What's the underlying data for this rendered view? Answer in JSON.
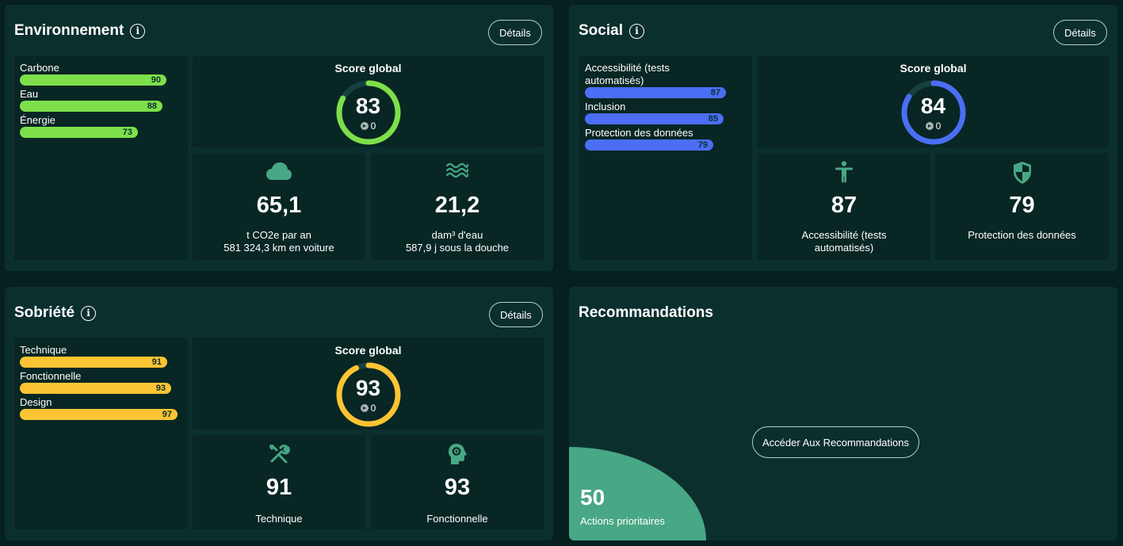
{
  "colors": {
    "env": "#7ddf4a",
    "social": "#4b6ef5",
    "sobriety": "#fbc432",
    "icon": "#48a784",
    "track": "#174140"
  },
  "environment": {
    "title": "Environnement",
    "details": "Détails",
    "bars": [
      {
        "label": "Carbone",
        "value": 90
      },
      {
        "label": "Eau",
        "value": 88
      },
      {
        "label": "Énergie",
        "value": 73
      }
    ],
    "score_title": "Score global",
    "score": 83,
    "score_delta": "0",
    "stats": [
      {
        "icon": "cloud-icon",
        "value": "65,1",
        "caption1": "t CO2e par an",
        "caption2": "581 324,3 km en voiture"
      },
      {
        "icon": "water-waves-icon",
        "value": "21,2",
        "caption1": "dam³ d'eau",
        "caption2": "587,9 j sous la douche"
      }
    ]
  },
  "social": {
    "title": "Social",
    "details": "Détails",
    "bars": [
      {
        "label": "Accessibilité (tests automatisés)",
        "value": 87
      },
      {
        "label": "Inclusion",
        "value": 85
      },
      {
        "label": "Protection des données",
        "value": 79
      }
    ],
    "score_title": "Score global",
    "score": 84,
    "score_delta": "0",
    "stats": [
      {
        "icon": "accessibility-person-icon",
        "value": "87",
        "caption1": "Accessibilité (tests automatisés)"
      },
      {
        "icon": "shield-icon",
        "value": "79",
        "caption1": "Protection des données"
      }
    ]
  },
  "sobriety": {
    "title": "Sobriété",
    "details": "Détails",
    "bars": [
      {
        "label": "Technique",
        "value": 91
      },
      {
        "label": "Fonctionnelle",
        "value": 93
      },
      {
        "label": "Design",
        "value": 97
      }
    ],
    "score_title": "Score global",
    "score": 93,
    "score_delta": "0",
    "stats": [
      {
        "icon": "tools-icon",
        "value": "91",
        "caption1": "Technique"
      },
      {
        "icon": "head-gear-icon",
        "value": "93",
        "caption1": "Fonctionnelle"
      }
    ]
  },
  "recommendations": {
    "title": "Recommandations",
    "button": "Accéder Aux Recommandations",
    "count": "50",
    "count_label": "Actions prioritaires"
  }
}
